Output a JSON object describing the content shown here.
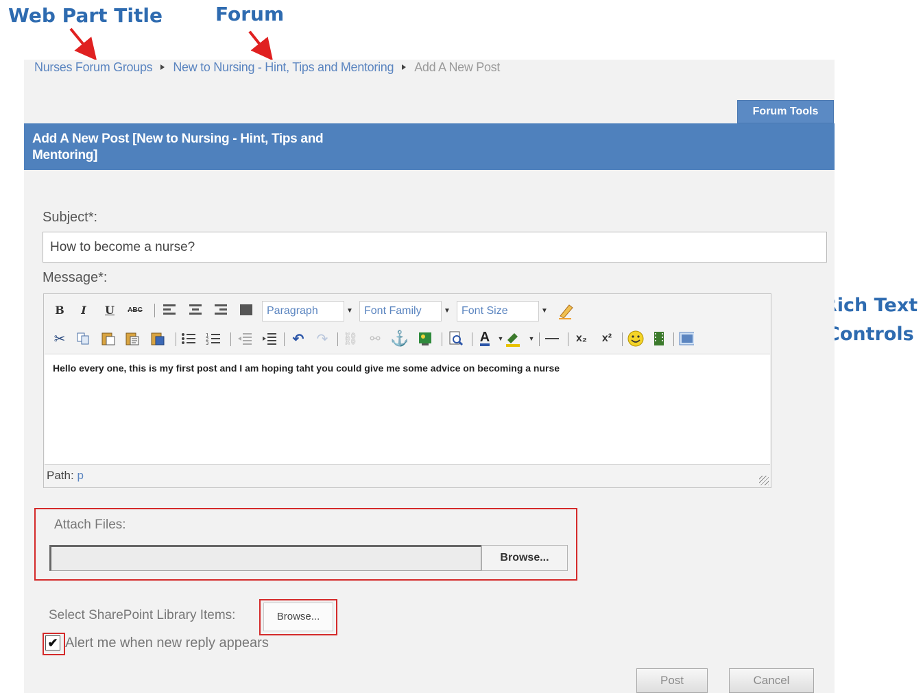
{
  "annotations": {
    "web_part_title": "Web Part Title",
    "forum": "Forum",
    "rich_text_line1": "Rich Text",
    "rich_text_line2": "Controls"
  },
  "breadcrumb": {
    "items": [
      "Nurses Forum Groups",
      "New to Nursing - Hint, Tips and Mentoring"
    ],
    "current": "Add A New Post"
  },
  "forum_tools_label": "Forum Tools",
  "header": {
    "title": "Add A New Post [New to Nursing - Hint, Tips and Mentoring]"
  },
  "form": {
    "subject_label": "Subject*:",
    "subject_value": "How to become a nurse?",
    "message_label": "Message*:",
    "message_text": "Hello every one, this is my first post and I am hoping taht you could give me some advice on becoming a nurse",
    "path_label": "Path:",
    "path_value": "p",
    "attach_label": "Attach Files:",
    "browse_file_label": "Browse...",
    "sharepoint_label": "Select SharePoint Library Items:",
    "browse_library_label": "Browse...",
    "alert_label": "Alert me when new reply appears",
    "alert_checked": true,
    "post_label": "Post",
    "cancel_label": "Cancel"
  },
  "editor_toolbar": {
    "paragraph_select": "Paragraph",
    "font_family_select": "Font Family",
    "font_size_select": "Font Size",
    "bold_glyph": "B",
    "italic_glyph": "I",
    "underline_glyph": "U",
    "strike_glyph": "ABC",
    "superscript_glyph": "x²",
    "subscript_glyph": "x₂",
    "font_color_glyph": "A"
  },
  "colors": {
    "accent": "#4f81bd",
    "annotation": "#2e6bb0",
    "highlight_border": "#d42a2a",
    "link": "#5b85c0"
  }
}
